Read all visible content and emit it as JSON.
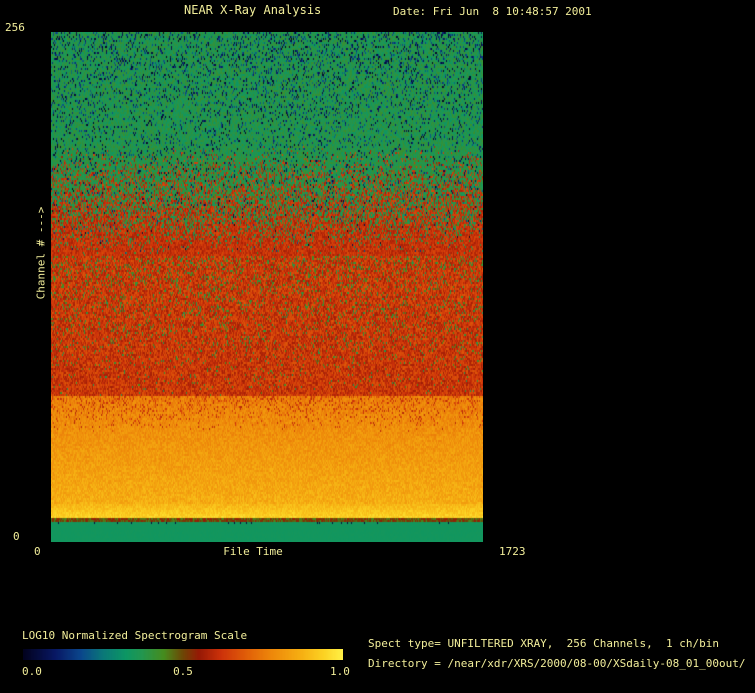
{
  "header": {
    "title": "NEAR X-Ray Analysis",
    "date_label": "Date: Fri Jun  8 10:48:57 2001"
  },
  "plot": {
    "y_axis": {
      "label": "Channel # --->",
      "max_tick": "256",
      "min_tick": "0"
    },
    "x_axis": {
      "label": "File Time",
      "min_tick": "0",
      "max_tick": "1723"
    }
  },
  "colorbar": {
    "title": "LOG10 Normalized Spectrogram Scale",
    "ticks": [
      "0.0",
      "0.5",
      "1.0"
    ]
  },
  "info": {
    "spect_line": "Spect type= UNFILTERED XRAY,  256 Channels,  1 ch/bin",
    "directory_line": "Directory = /near/xdr/XRS/2000/08-00/XSdaily-08_01_00out/"
  },
  "colors": {
    "background": "#000000",
    "text": "#f2ee9a",
    "top_green": "#2a9655",
    "mid_red": "#cc3311",
    "orange_band": "#ee8811",
    "bright_yellow": "#f8cc30",
    "bottom_teal": "#0d9b65"
  },
  "chart_data": {
    "type": "heatmap",
    "title": "NEAR X-Ray Analysis",
    "xlabel": "File Time",
    "ylabel": "Channel # --->",
    "x_range": [
      0,
      1723
    ],
    "y_range": [
      0,
      256
    ],
    "scale_label": "LOG10 Normalized Spectrogram Scale",
    "scale_range": [
      0.0,
      1.0
    ],
    "legend_position": "bottom-left colorbar",
    "grid": false,
    "description": "Spectrogram of normalized log10 X-ray counts vs channel (vertical, 0 bottom to 256 top) and file time (horizontal 0-1723). High channels are low intensity (green noise with dark speckles), mid channels medium-high (red), channels ~19-74 high intensity (orange brightening to yellow near channel ~14), a thin dark row near channel 12, and channels 0-11 a uniform teal value ~0.33.",
    "colormap_stops": [
      [
        0.0,
        2,
        2,
        30
      ],
      [
        0.1,
        8,
        24,
        100
      ],
      [
        0.18,
        10,
        70,
        140
      ],
      [
        0.25,
        10,
        120,
        120
      ],
      [
        0.32,
        12,
        150,
        100
      ],
      [
        0.37,
        34,
        150,
        80
      ],
      [
        0.44,
        70,
        140,
        30
      ],
      [
        0.5,
        110,
        70,
        5
      ],
      [
        0.55,
        150,
        25,
        5
      ],
      [
        0.62,
        205,
        50,
        10
      ],
      [
        0.7,
        225,
        95,
        8
      ],
      [
        0.78,
        238,
        137,
        10
      ],
      [
        0.87,
        246,
        175,
        18
      ],
      [
        0.94,
        252,
        210,
        35
      ],
      [
        1.0,
        255,
        240,
        70
      ]
    ],
    "bands": [
      {
        "kind": "speckled",
        "t0": 0.0,
        "t1": 0.2216,
        "base": 0.37,
        "noise": 0.1,
        "dark_p0": 0.2,
        "dark_p1": 0.1,
        "dark_max": 0.24
      },
      {
        "kind": "mix",
        "t0": 0.2216,
        "t1": 0.437,
        "low": 0.375,
        "high": 0.615,
        "noise": 0.1,
        "dark_p0": 0.09,
        "dark_p1": 0.0,
        "dark_max": 0.24
      },
      {
        "kind": "speckled2",
        "t0": 0.437,
        "t1": 0.712,
        "base": 0.625,
        "noise": 0.13,
        "alt": 0.41,
        "alt_p0": 0.16,
        "alt_p1": 0.02
      },
      {
        "kind": "ramp",
        "t0": 0.712,
        "t1": 0.922,
        "v0": 0.765,
        "v1": 0.865,
        "noise": 0.09,
        "alt": 0.63,
        "alt_p0": 0.22,
        "alt_p1": 0.0,
        "alt_span": 0.35
      },
      {
        "kind": "ramp",
        "t0": 0.922,
        "t1": 0.951,
        "v0": 0.88,
        "v1": 0.94,
        "noise": 0.07
      },
      {
        "kind": "flat",
        "t0": 0.951,
        "t1": 0.958,
        "base": 0.5,
        "noise": 0.12
      },
      {
        "kind": "flat",
        "t0": 0.958,
        "t1": 1.001,
        "base": 0.335,
        "noise": 0.01,
        "edge_dark_p": 0.05
      }
    ]
  }
}
